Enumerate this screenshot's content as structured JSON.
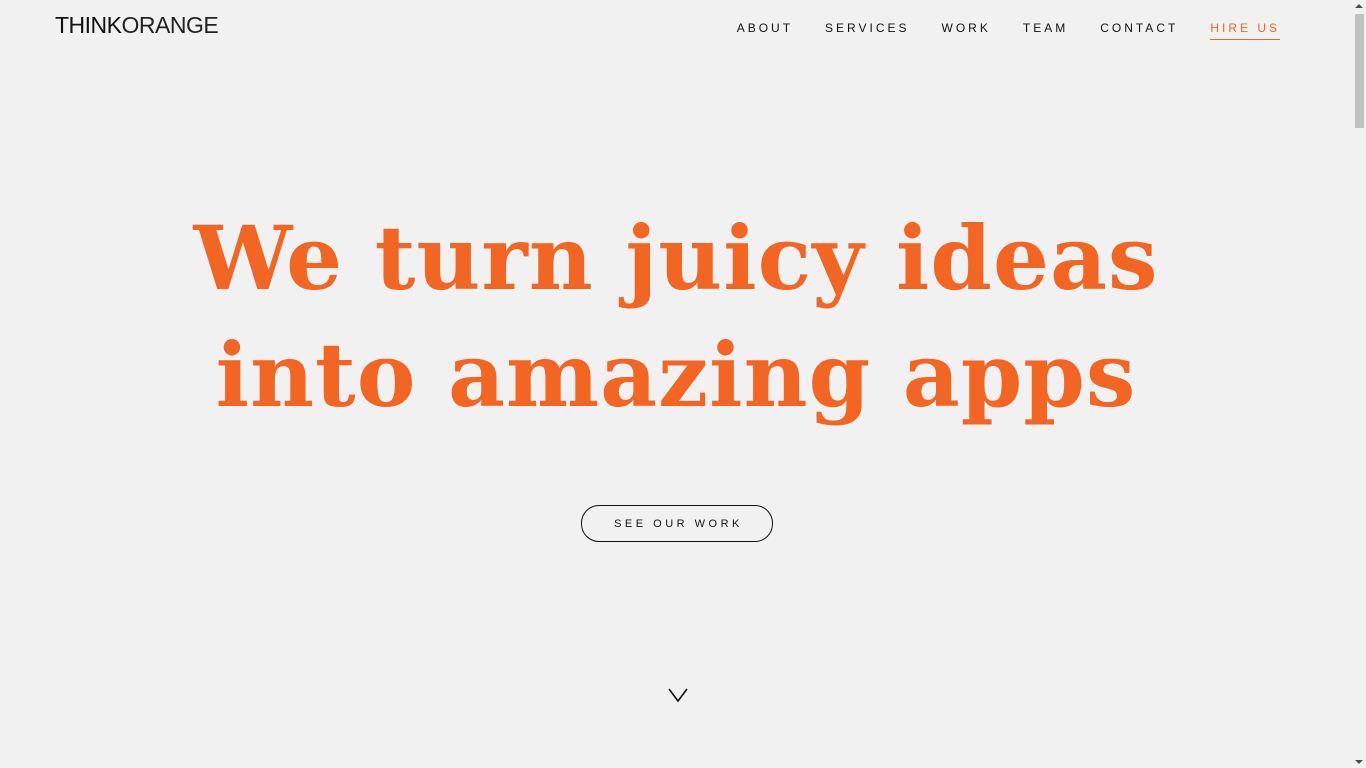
{
  "header": {
    "logo_bold": "THINK",
    "logo_light": "ORANGE"
  },
  "nav": {
    "items": [
      {
        "label": "ABOUT"
      },
      {
        "label": "SERVICES"
      },
      {
        "label": "WORK"
      },
      {
        "label": "TEAM"
      },
      {
        "label": "CONTACT"
      },
      {
        "label": "HIRE US"
      }
    ]
  },
  "hero": {
    "line1": "We turn juicy ideas",
    "line2": "into amazing apps"
  },
  "cta": {
    "label": "SEE OUR WORK"
  },
  "icons": {
    "scroll_down": "chevron-down-icon"
  },
  "colors": {
    "accent": "#f26522",
    "background": "#f1f1f1",
    "text": "#111111"
  }
}
